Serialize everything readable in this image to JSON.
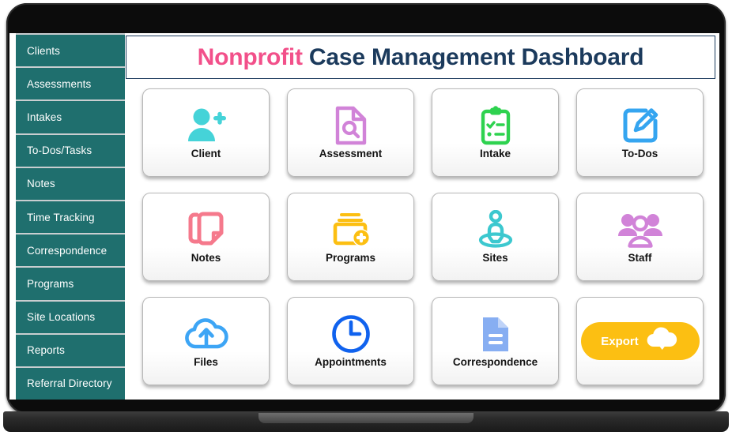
{
  "header": {
    "title_brand": "Nonprofit",
    "title_rest": " Case Management Dashboard"
  },
  "sidebar": {
    "items": [
      {
        "label": "Clients"
      },
      {
        "label": "Assessments"
      },
      {
        "label": "Intakes"
      },
      {
        "label": "To-Dos/Tasks"
      },
      {
        "label": "Notes"
      },
      {
        "label": "Time Tracking"
      },
      {
        "label": "Correspondence"
      },
      {
        "label": "Programs"
      },
      {
        "label": "Site Locations"
      },
      {
        "label": "Reports"
      },
      {
        "label": "Referral Directory"
      }
    ]
  },
  "grid": {
    "cards": [
      {
        "label": "Client",
        "icon": "user-plus-icon",
        "color": "#45d3d8"
      },
      {
        "label": "Assessment",
        "icon": "document-search-icon",
        "color": "#d183d8"
      },
      {
        "label": "Intake",
        "icon": "clipboard-check-icon",
        "color": "#2ed24f"
      },
      {
        "label": "To-Dos",
        "icon": "edit-square-icon",
        "color": "#35a5f0"
      },
      {
        "label": "Notes",
        "icon": "notes-stack-icon",
        "color": "#f5798c"
      },
      {
        "label": "Programs",
        "icon": "folder-plus-icon",
        "color": "#fcbf12"
      },
      {
        "label": "Sites",
        "icon": "location-person-icon",
        "color": "#3cc8cf"
      },
      {
        "label": "Staff",
        "icon": "people-group-icon",
        "color": "#d183d8"
      },
      {
        "label": "Files",
        "icon": "cloud-upload-icon",
        "color": "#3da5f5"
      },
      {
        "label": "Appointments",
        "icon": "clock-icon",
        "color": "#1062ee"
      },
      {
        "label": "Correspondence",
        "icon": "document-lines-icon",
        "color": "#87aef2"
      },
      {
        "label": "Export",
        "icon": "cloud-download-icon",
        "color": "#fcbf12"
      }
    ],
    "export_label": "Export"
  },
  "colors": {
    "sidebar_teal": "#1f6f6e",
    "title_navy": "#1b3a5c",
    "brand_pink": "#f2508a",
    "export_amber": "#fcbf12"
  }
}
